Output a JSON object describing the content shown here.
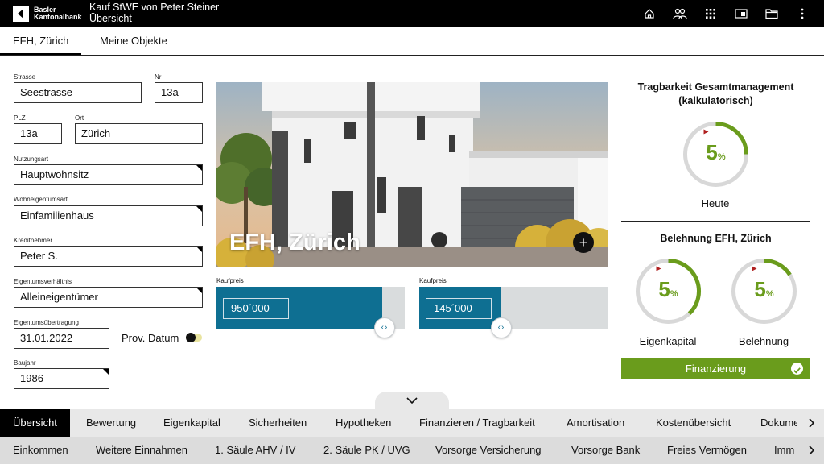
{
  "app": {
    "logo_text": "Basler\nKantonalbank",
    "title_line1": "Kauf StWE von Peter Steiner",
    "title_line2": "Übersicht",
    "icons": [
      "home-icon",
      "users-icon",
      "apps-grid-icon",
      "calculator-icon",
      "folder-icon",
      "more-vertical-icon"
    ]
  },
  "object_tabs": [
    {
      "label": "EFH, Zürich",
      "active": true
    },
    {
      "label": "Meine Objekte",
      "active": false
    }
  ],
  "form": {
    "strasse": {
      "label": "Strasse",
      "value": "Seestrasse"
    },
    "nr": {
      "label": "Nr",
      "value": "13a"
    },
    "plz": {
      "label": "PLZ",
      "value": "13a"
    },
    "ort": {
      "label": "Ort",
      "value": "Zürich"
    },
    "nutzungsart": {
      "label": "Nutzungsart",
      "value": "Hauptwohnsitz"
    },
    "wohneigentumsart": {
      "label": "Wohneigentumsart",
      "value": "Einfamilienhaus"
    },
    "kreditnehmer": {
      "label": "Kreditnehmer",
      "value": "Peter S."
    },
    "eigentumsverhaeltnis": {
      "label": "Eigentumsverhältnis",
      "value": "Alleineigentümer"
    },
    "eigentumsuebertragung": {
      "label": "Eigentumsübertragung",
      "value": "31.01.2022"
    },
    "prov_datum": {
      "label": "Prov. Datum",
      "on": false
    },
    "baujahr": {
      "label": "Baujahr",
      "value": "1986"
    }
  },
  "photo": {
    "title": "EFH, Zürich"
  },
  "kaufpreis": [
    {
      "label": "Kaufpreis",
      "value": "950´000",
      "fill_fraction": 0.88
    },
    {
      "label": "Kaufpreis",
      "value": "145´000",
      "fill_fraction": 0.43
    }
  ],
  "right_panel": {
    "tragbarkeit_title": "Tragbarkeit Gesamtmanagement\n(kalkulatorisch)",
    "heute": {
      "value": "5",
      "unit": "%",
      "caption": "Heute",
      "fraction": 0.25
    },
    "belehnung_title": "Belehnung EFH, Zürich",
    "eigenkapital": {
      "value": "5",
      "unit": "%",
      "caption": "Eigenkapital",
      "fraction": 0.38
    },
    "belehnung": {
      "value": "5",
      "unit": "%",
      "caption": "Belehnung",
      "fraction": 0.16
    },
    "finanzierung_label": "Finanzierung",
    "colors": {
      "green": "#6a9c1c",
      "blue": "#0e6f92",
      "marker": "#b02020"
    }
  },
  "nav_primary": [
    {
      "label": "Übersicht",
      "active": true
    },
    {
      "label": "Bewertung",
      "active": false
    },
    {
      "label": "Eigenkapital",
      "active": false
    },
    {
      "label": "Sicherheiten",
      "active": false
    },
    {
      "label": "Hypotheken",
      "active": false
    },
    {
      "label": "Finanzieren / Tragbarkeit",
      "active": false
    },
    {
      "label": "Amortisation",
      "active": false
    },
    {
      "label": "Kostenübersicht",
      "active": false
    },
    {
      "label": "Dokume",
      "active": false
    }
  ],
  "nav_secondary": [
    {
      "label": "Einkommen"
    },
    {
      "label": "Weitere Einnahmen"
    },
    {
      "label": "1. Säule AHV / IV"
    },
    {
      "label": "2. Säule PK / UVG"
    },
    {
      "label": "Vorsorge Versicherung"
    },
    {
      "label": "Vorsorge Bank"
    },
    {
      "label": "Freies Vermögen"
    },
    {
      "label": "Imm"
    }
  ]
}
